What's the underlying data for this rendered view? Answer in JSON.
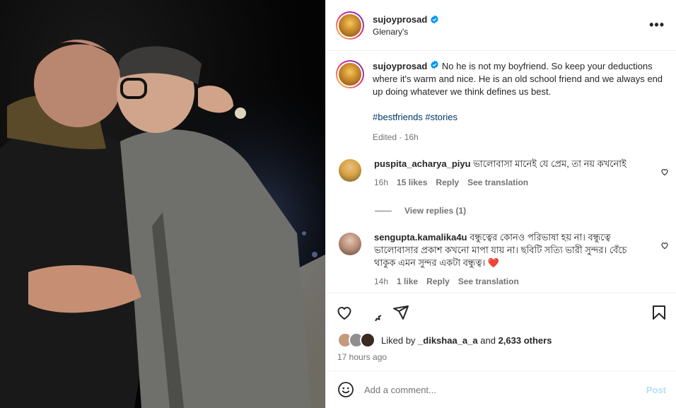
{
  "header": {
    "username": "sujoyprosad",
    "location": "Glenary's",
    "more_label": "•••"
  },
  "caption": {
    "username": "sujoyprosad",
    "text": "No he is not my boyfriend. So keep your deductions where it's warm and nice. He is an old school friend and we always end up doing whatever we think defines us best.",
    "hashtags": "#bestfriends #stories",
    "edited": "Edited",
    "time": "16h"
  },
  "comments": [
    {
      "username": "puspita_acharya_piyu",
      "text": "ভালোবাসা মানেই যে প্রেম, তা নয় কখনোই",
      "time": "16h",
      "likes": "15 likes",
      "reply": "Reply",
      "translate": "See translation",
      "avatar_color": "#d9a441"
    },
    {
      "username": "sengupta.kamalika4u",
      "text": "বন্ধুত্বের কোনও পরিভাষা হয় না। বন্ধুত্বে ভালোবাসার প্রকাশ কখনো মাপা যায় না। ছবিটি সত্যি ভারী সুন্দর। বেঁচে থাকুক এমন সুন্দর একটা বন্ধুত্ব। ❤️",
      "time": "14h",
      "likes": "1 like",
      "reply": "Reply",
      "translate": "See translation",
      "avatar_color": "#b58a73"
    }
  ],
  "view_replies": "View replies (1)",
  "likes": {
    "prefix": "Liked by",
    "user": "_dikshaa_a_a",
    "and": "and",
    "others": "2,633 others"
  },
  "posted_time": "17 hours ago",
  "add_comment": {
    "placeholder": "Add a comment...",
    "post_label": "Post"
  },
  "colors": {
    "link": "#00376b",
    "muted": "#737373",
    "verified": "#0095f6",
    "post_disabled": "#b2dffc"
  }
}
